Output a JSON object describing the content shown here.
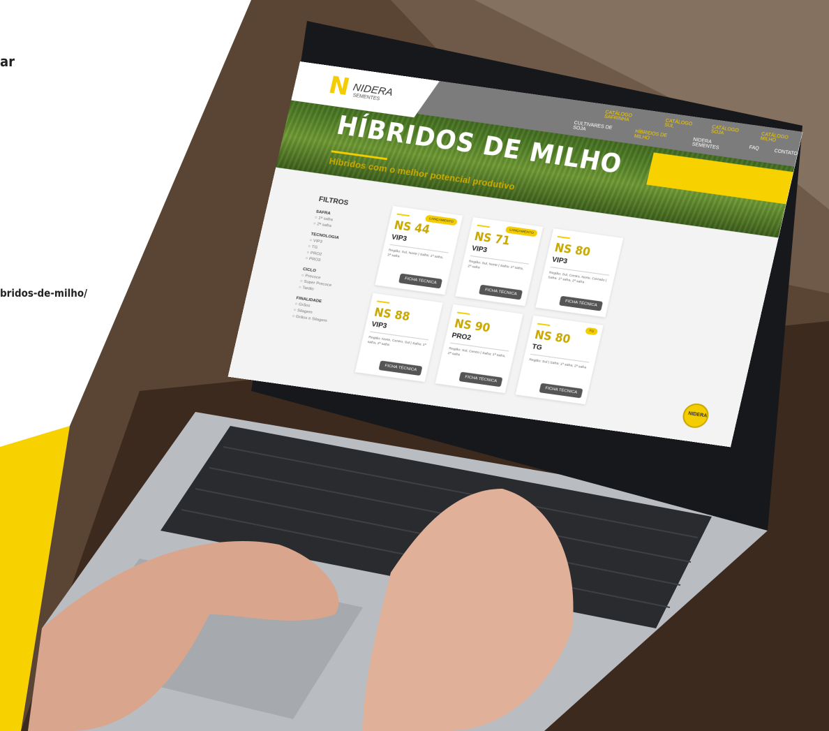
{
  "left_text": {
    "line1": "ar",
    "line2": "bridos-de-milho/"
  },
  "site": {
    "logo_text": "NIDERA",
    "logo_sub": "SEMENTES",
    "nav_top": [
      "CATÁLOGO SAFRINHA",
      "CATÁLOGO SUL",
      "CATÁLOGO SOJA",
      "CATÁLOGO MILHO"
    ],
    "nav_bottom": [
      "CULTIVARES DE SOJA",
      "HÍBRIDOS DE MILHO",
      "NIDERA SEMENTES",
      "FAQ",
      "CONTATO"
    ],
    "title": "HÍBRIDOS DE MILHO",
    "subtitle": "Híbridos com o melhor potencial produtivo",
    "filters": {
      "heading": "FILTROS",
      "groups": [
        {
          "name": "SAFRA",
          "options": [
            "1ª safra",
            "2ª safra"
          ]
        },
        {
          "name": "TECNOLOGIA",
          "options": [
            "VIP3",
            "TG",
            "PRO2",
            "PRO3"
          ]
        },
        {
          "name": "CICLO",
          "options": [
            "Precoce",
            "Super Precoce",
            "Tardio"
          ]
        },
        {
          "name": "FINALIDADE",
          "options": [
            "Grãos",
            "Silagem",
            "Grãos e Silagem"
          ]
        }
      ]
    },
    "cards": [
      {
        "name": "NS 44",
        "tech": "VIP3",
        "badge": "LANÇAMENTO",
        "region": "Região: Sul, Norte | Safra: 1ª safra, 2ª safra",
        "button": "FICHA TÉCNICA"
      },
      {
        "name": "NS 71",
        "tech": "VIP3",
        "badge": "LANÇAMENTO",
        "region": "Região: Sul, Norte | Safra: 1ª safra, 2ª safra",
        "button": "FICHA TÉCNICA"
      },
      {
        "name": "NS 80",
        "tech": "VIP3",
        "badge": "",
        "region": "Região: Sul, Centro, Norte, Cerrado | Safra: 1ª safra, 2ª safra",
        "button": "FICHA TÉCNICA"
      },
      {
        "name": "NS 88",
        "tech": "VIP3",
        "badge": "",
        "region": "Região: Norte, Centro, Sul | Safra: 1ª safra, 2ª safra",
        "button": "FICHA TÉCNICA"
      },
      {
        "name": "NS 90",
        "tech": "PRO2",
        "badge": "",
        "region": "Região: Sul, Centro | Safra: 1ª safra, 2ª safra",
        "button": "FICHA TÉCNICA"
      },
      {
        "name": "NS 80",
        "tech": "TG",
        "badge": "TG",
        "region": "Região: Sul | Safra: 1ª safra, 2ª safra",
        "button": "FICHA TÉCNICA"
      }
    ],
    "seal_text": "NIDERA"
  },
  "colors": {
    "brand_yellow": "#f8d100",
    "nav_gray": "#7c7c7c"
  }
}
